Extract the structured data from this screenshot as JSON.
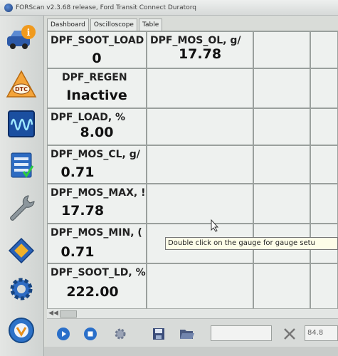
{
  "window": {
    "title": "FORScan v2.3.68 release, Ford Transit Connect Duratorq"
  },
  "tabs": [
    "Dashboard",
    "Oscilloscope",
    "Table"
  ],
  "gauges": [
    {
      "label": "DPF_SOOT_LOAD",
      "value": "0"
    },
    {
      "label": "DPF_MOS_OL, g/",
      "value": "17.78"
    },
    {
      "label": "DPF_REGEN",
      "value": "Inactive"
    },
    {
      "label": "DPF_LOAD, %",
      "value": "8.00"
    },
    {
      "label": "DPF_MOS_CL, g/",
      "value": "0.71"
    },
    {
      "label": "DPF_MOS_MAX, !",
      "value": "17.78"
    },
    {
      "label": "DPF_MOS_MIN, (",
      "value": "0.71"
    },
    {
      "label": "DPF_SOOT_LD, %",
      "value": "222.00"
    }
  ],
  "tooltip": "Double click on the gauge for gauge setu",
  "toolbar": {
    "right_value": "84.8"
  },
  "sidebar": {
    "items": [
      {
        "icon": "car-info-icon"
      },
      {
        "icon": "dtc-icon"
      },
      {
        "icon": "oscilloscope-icon"
      },
      {
        "icon": "checklist-icon"
      },
      {
        "icon": "wrench-icon"
      },
      {
        "icon": "chip-icon"
      },
      {
        "icon": "gear-icon"
      },
      {
        "icon": "help-icon"
      }
    ]
  },
  "colors": {
    "accent_blue": "#2a6fc9",
    "accent_orange": "#e8901c",
    "grid_bg": "#eef1ef",
    "tooltip_bg": "#fdfde8"
  }
}
